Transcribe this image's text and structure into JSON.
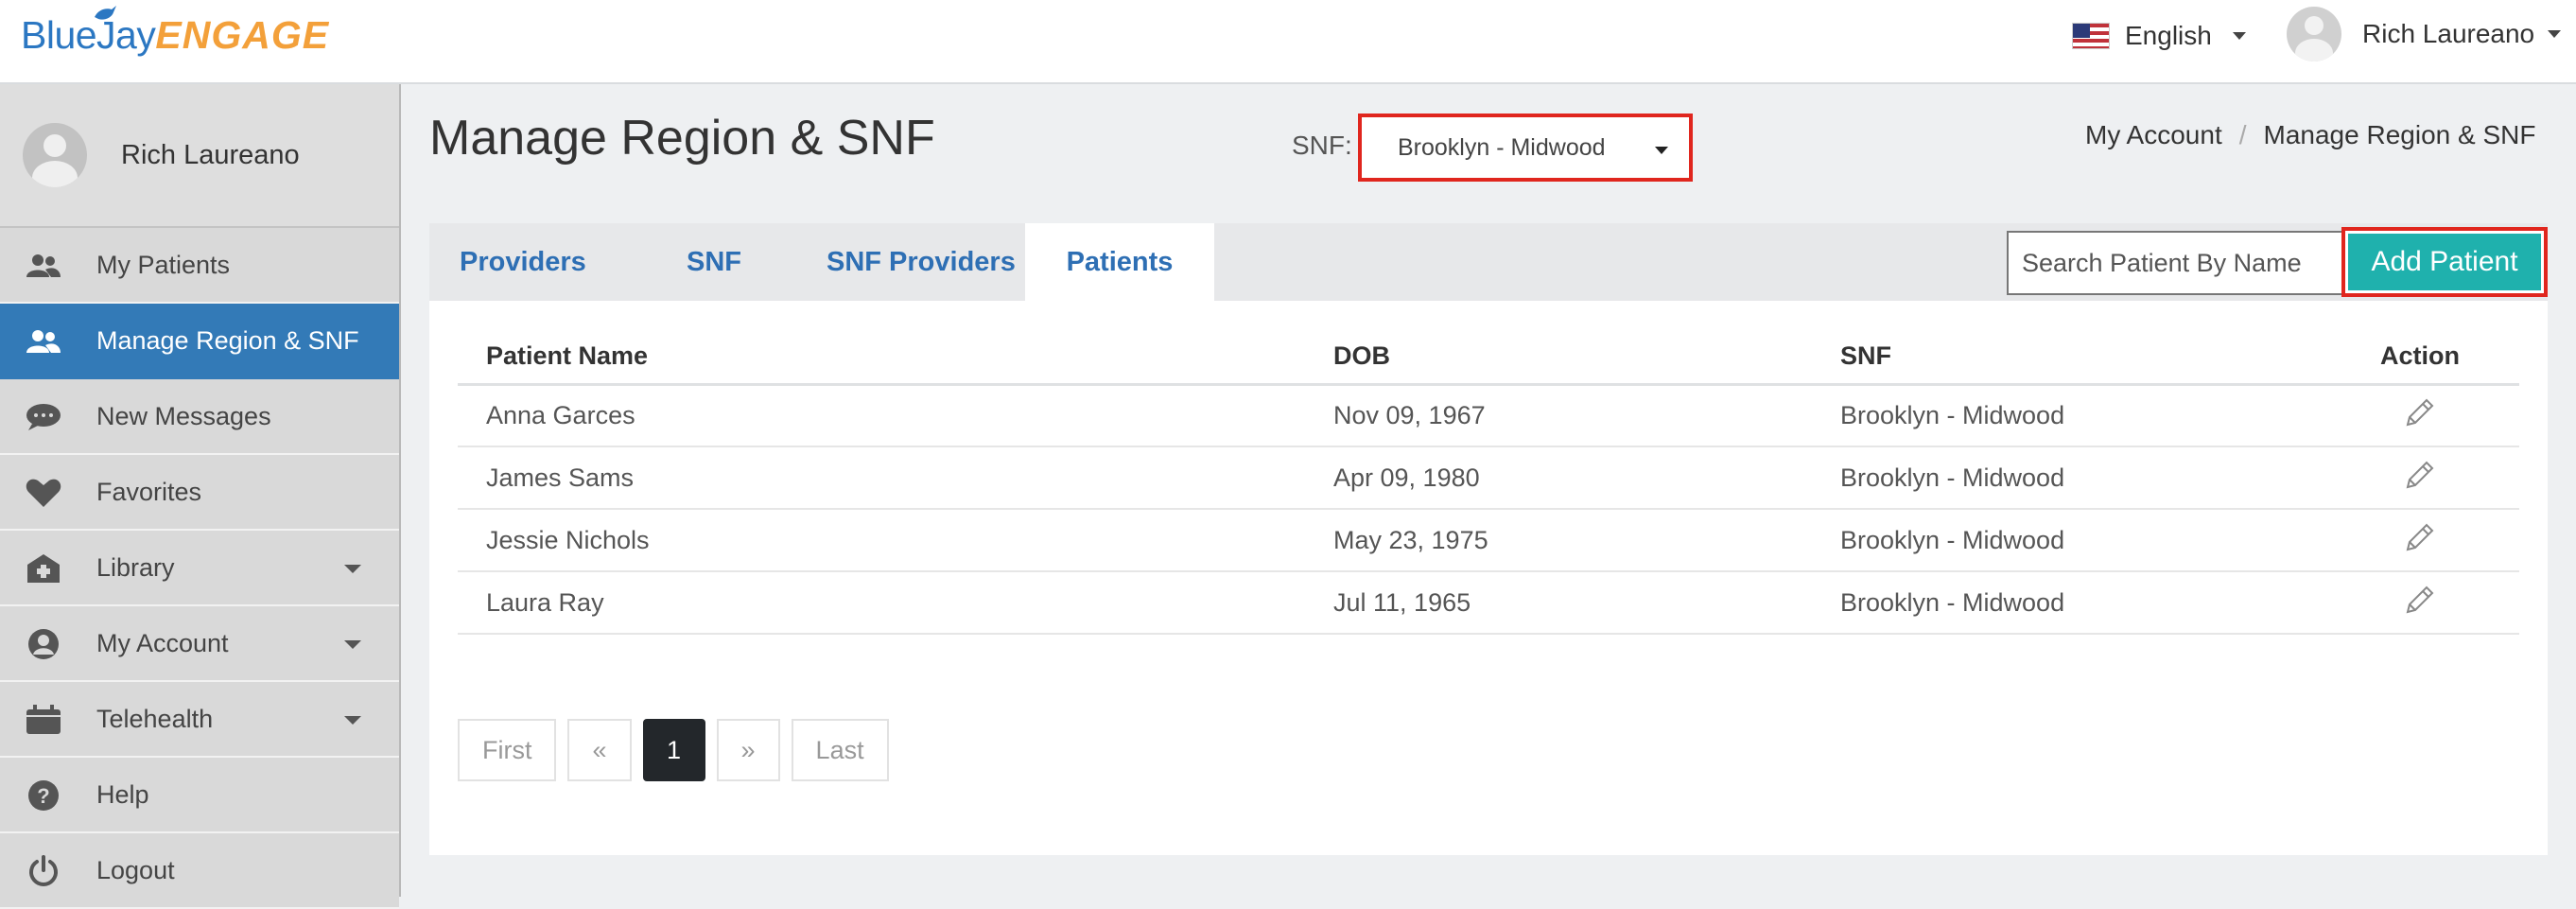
{
  "brand": {
    "part1": "BlueJay",
    "part2": "ENGAGE"
  },
  "header": {
    "language": "English",
    "user_name": "Rich Laureano"
  },
  "sidebar": {
    "user_name": "Rich Laureano",
    "items": [
      {
        "label": "My Patients",
        "icon": "users-icon"
      },
      {
        "label": "Manage Region & SNF",
        "icon": "users-icon",
        "active": true
      },
      {
        "label": "New Messages",
        "icon": "chat-bubble-icon"
      },
      {
        "label": "Favorites",
        "icon": "heart-icon"
      },
      {
        "label": "Library",
        "icon": "library-icon",
        "dropdown": true
      },
      {
        "label": "My Account",
        "icon": "account-icon",
        "dropdown": true
      },
      {
        "label": "Telehealth",
        "icon": "calendar-icon",
        "dropdown": true
      },
      {
        "label": "Help",
        "icon": "help-icon"
      },
      {
        "label": "Logout",
        "icon": "power-icon"
      }
    ]
  },
  "main": {
    "title": "Manage Region & SNF",
    "snf_label": "SNF:",
    "snf_selected": "Brooklyn - Midwood",
    "breadcrumb": [
      "My Account",
      "/",
      "Manage Region & SNF"
    ],
    "tabs": [
      "Providers",
      "SNF",
      "SNF Providers",
      "Patients"
    ],
    "active_tab": "Patients",
    "search_placeholder": "Search Patient By Name",
    "add_button": "Add Patient",
    "table": {
      "columns": [
        "Patient Name",
        "DOB",
        "SNF",
        "Action"
      ],
      "rows": [
        [
          "Anna Garces",
          "Nov 09, 1967",
          "Brooklyn - Midwood"
        ],
        [
          "James Sams",
          "Apr 09, 1980",
          "Brooklyn - Midwood"
        ],
        [
          "Jessie Nichols",
          "May 23, 1975",
          "Brooklyn - Midwood"
        ],
        [
          "Laura Ray",
          "Jul 11, 1965",
          "Brooklyn - Midwood"
        ]
      ]
    },
    "pagination": [
      "First",
      "«",
      "1",
      "»",
      "Last"
    ]
  },
  "colors": {
    "accent": "#337ab7",
    "add_button": "#1fb1ad",
    "highlight": "#e0261e",
    "tab_text": "#2e6fb4"
  }
}
